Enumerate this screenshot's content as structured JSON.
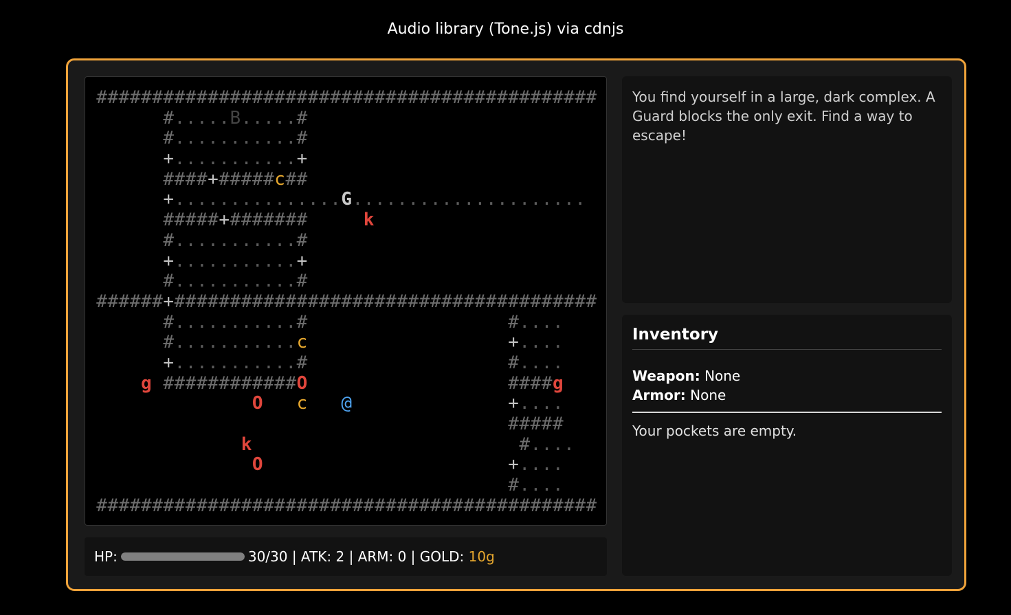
{
  "header": {
    "title": "Audio library (Tone.js) via cdnjs"
  },
  "map": {
    "rows": [
      "#############################################",
      "      #.....B.....#                          ",
      "      #...........#                          ",
      "      +...........+                          ",
      "      ####+#####c##                          ",
      "      +...............G.....................",
      "      #####+#######     k                    ",
      "      #...........#                          ",
      "      +...........+                          ",
      "      #...........#                          ",
      "######+######################################",
      "      #...........#                  #....",
      "      #...........c                  +....",
      "      +...........#                  #....",
      "    g ############O                  ####g",
      "              O   c   @              +....",
      "                                     #####",
      "             k                        #....",
      "              O                      +....",
      "                                     #....",
      "#############################################"
    ]
  },
  "status": {
    "hp_label": "HP:",
    "hp_current": 30,
    "hp_max": 30,
    "hp_fraction": 1.0,
    "stats_text": "30/30 | ATK: 2 | ARM: 0 | GOLD:",
    "gold_text": "10g"
  },
  "log": {
    "message": "You find yourself in a large, dark complex. A Guard blocks the only exit. Find a way to escape!"
  },
  "inventory": {
    "title": "Inventory",
    "weapon_label": "Weapon:",
    "weapon_value": "None",
    "armor_label": "Armor:",
    "armor_value": "None",
    "empty_text": "Your pockets are empty."
  },
  "colors": {
    "frame_accent": "#f0a33a",
    "gold": "#e6a72e",
    "enemy_red": "#e0463c",
    "player_blue": "#4ea3f0"
  }
}
